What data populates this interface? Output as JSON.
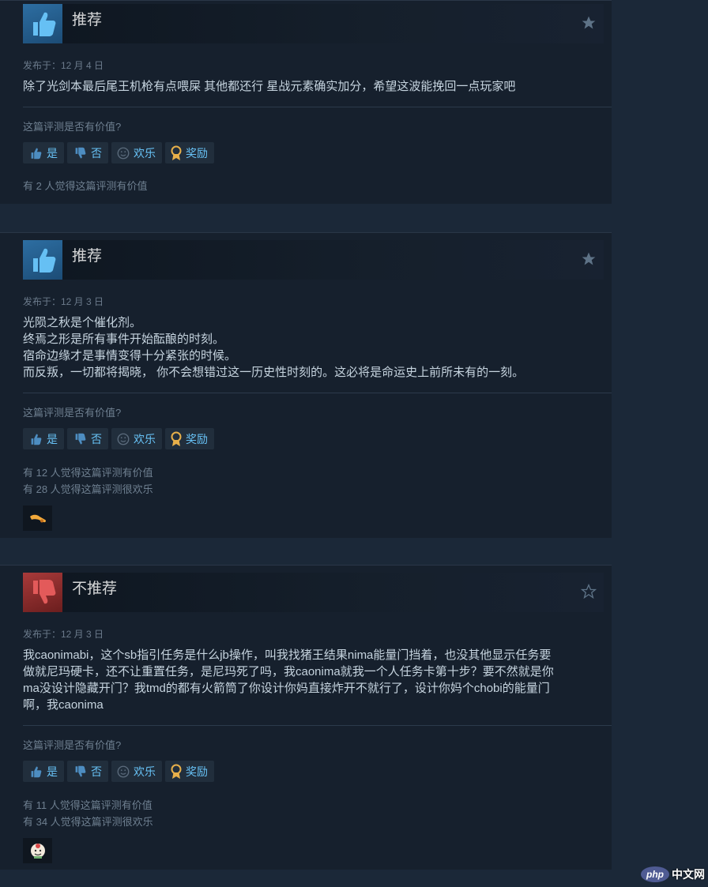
{
  "reviews": [
    {
      "verdict": "推荐",
      "posted": "发布于：12 月 4 日",
      "content": [
        "除了光剑本最后尾王机枪有点喂屎 其他都还行 星战元素确实加分，希望这波能挽回一点玩家吧"
      ],
      "question": "这篇评测是否有价值?",
      "buttons": {
        "yes": "是",
        "no": "否",
        "funny": "欢乐",
        "award": "奖励"
      },
      "stats": [
        "有 2 人觉得这篇评测有价值"
      ]
    },
    {
      "verdict": "推荐",
      "posted": "发布于：12 月 3 日",
      "content": [
        "光陨之秋是个催化剂。",
        "终焉之形是所有事件开始酝酿的时刻。",
        "宿命边缘才是事情变得十分紧张的时候。",
        "而反叛，一切都将揭晓， 你不会想错过这一历史性时刻的。这必将是命运史上前所未有的一刻。"
      ],
      "question": "这篇评测是否有价值?",
      "buttons": {
        "yes": "是",
        "no": "否",
        "funny": "欢乐",
        "award": "奖励"
      },
      "stats": [
        "有 12 人觉得这篇评测有价值",
        "有 28 人觉得这篇评测很欢乐"
      ]
    },
    {
      "verdict": "不推荐",
      "posted": "发布于：12 月 3 日",
      "content": [
        "我caonimabi，这个sb指引任务是什么jb操作，叫我找猪王结果nima能量门挡着，也没其他显示任务要",
        "做就尼玛硬卡，还不让重置任务，是尼玛死了吗，我caonima就我一个人任务卡第十步？要不然就是你",
        "ma没设计隐藏开门？我tmd的都有火箭筒了你设计你妈直接炸开不就行了，设计你妈个chobi的能量门",
        "啊，我caonima"
      ],
      "question": "这篇评测是否有价值?",
      "buttons": {
        "yes": "是",
        "no": "否",
        "funny": "欢乐",
        "award": "奖励"
      },
      "stats": [
        "有 11 人觉得这篇评测有价值",
        "有 34 人觉得这篇评测很欢乐"
      ]
    }
  ],
  "icons": {
    "recommend": "thumbs-up-icon",
    "not_recommend": "thumbs-down-icon",
    "bookmark": "star-icon",
    "funny": "smiley-icon",
    "award": "award-ribbon-icon"
  },
  "colors": {
    "page_bg": "#1b2838",
    "card_bg": "#16202d",
    "link": "#67c1f5",
    "text": "#c6d4df",
    "muted": "#6e7f90"
  },
  "watermark": {
    "logo": "php",
    "text": "中文网"
  }
}
